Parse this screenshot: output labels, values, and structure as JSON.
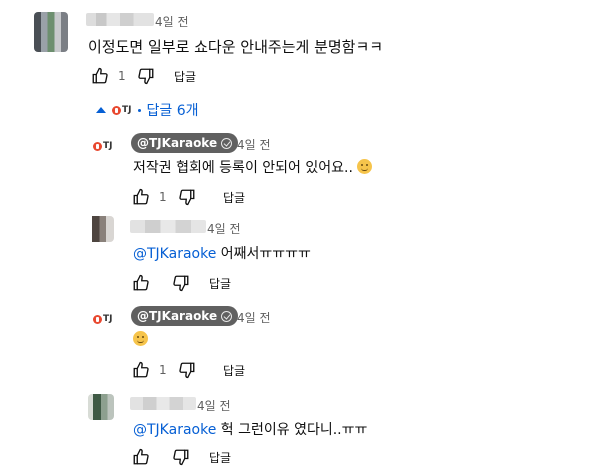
{
  "colors": {
    "link": "#065fd4",
    "text": "#0f0f0f",
    "meta": "#606060",
    "owner_chip": "#606060"
  },
  "top_comment": {
    "time": "4일 전",
    "text": "이정도면 일부로 쇼다운 안내주는게 분명함ㅋㅋ",
    "like_count": "1",
    "reply_label": "답글"
  },
  "replies_toggle": {
    "label": "답글 6개"
  },
  "replies": [
    {
      "author": "@TJKaraoke",
      "time": "4일 전",
      "text": "저작권 협회에 등록이 안되어 있어요..",
      "like_count": "1",
      "reply_label": "답글"
    },
    {
      "mention": "@TJKaraoke",
      "time": "4일 전",
      "text": " 어째서ㅠㅠㅠㅠ",
      "like_count": "",
      "reply_label": "답글"
    },
    {
      "author": "@TJKaraoke",
      "time": "4일 전",
      "text": "",
      "like_count": "1",
      "reply_label": "답글"
    },
    {
      "mention": "@TJKaraoke",
      "time": "4일 전",
      "text": " 헉 그런이유 였다니..ㅠㅠ",
      "like_count": "",
      "reply_label": "답글"
    }
  ],
  "channel_avatar_text": "TJ",
  "icons": {
    "like": "thumbs-up-icon",
    "dislike": "thumbs-down-icon",
    "verified": "check-circle-icon",
    "collapse": "caret-up-icon",
    "emoji": "slightly-smiling-emoji"
  }
}
